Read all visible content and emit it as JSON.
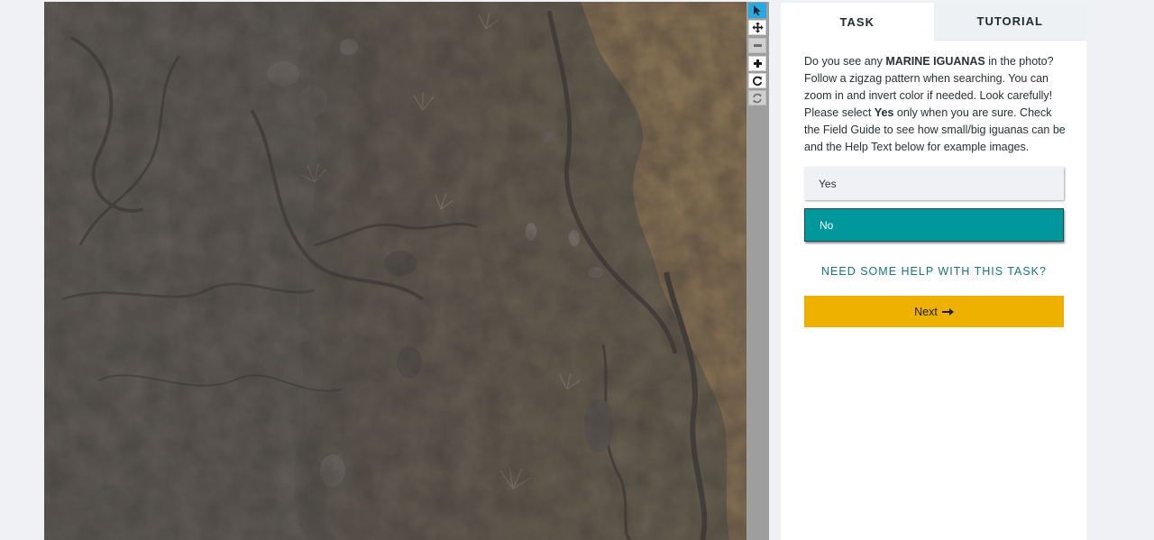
{
  "viewer": {
    "image_description_icon": "aerial-photo",
    "toolbar": [
      {
        "icon": "pointer-icon",
        "state": "active"
      },
      {
        "icon": "move-icon",
        "state": "normal"
      },
      {
        "icon": "zoom-out-icon",
        "state": "disabled"
      },
      {
        "icon": "zoom-in-icon",
        "state": "normal"
      },
      {
        "icon": "rotate-icon",
        "state": "normal"
      },
      {
        "icon": "reset-icon",
        "state": "disabled"
      }
    ]
  },
  "task_panel": {
    "tabs": [
      {
        "label": "TASK",
        "active": true
      },
      {
        "label": "TUTORIAL",
        "active": false
      }
    ],
    "instructions": {
      "part1": "Do you see any ",
      "bold1": "MARINE IGUANAS",
      "part2": " in the photo? Follow a zigzag pattern when searching. You can zoom in and invert color if needed. Look carefully! Please select ",
      "bold2": "Yes",
      "part3": " only when you are sure. Check the Field Guide to see how small/big iguanas can be and the Help Text below for example images."
    },
    "answers": {
      "yes": "Yes",
      "no": "No",
      "selected": "No"
    },
    "help_link": "NEED SOME HELP WITH THIS TASK?",
    "next_label": "Next",
    "next_icon": "arrow-right-icon"
  },
  "colors": {
    "selected_answer": "#00979d",
    "next_button": "#efb100",
    "active_tool": "#29a8e0",
    "help_link": "#16747b"
  }
}
